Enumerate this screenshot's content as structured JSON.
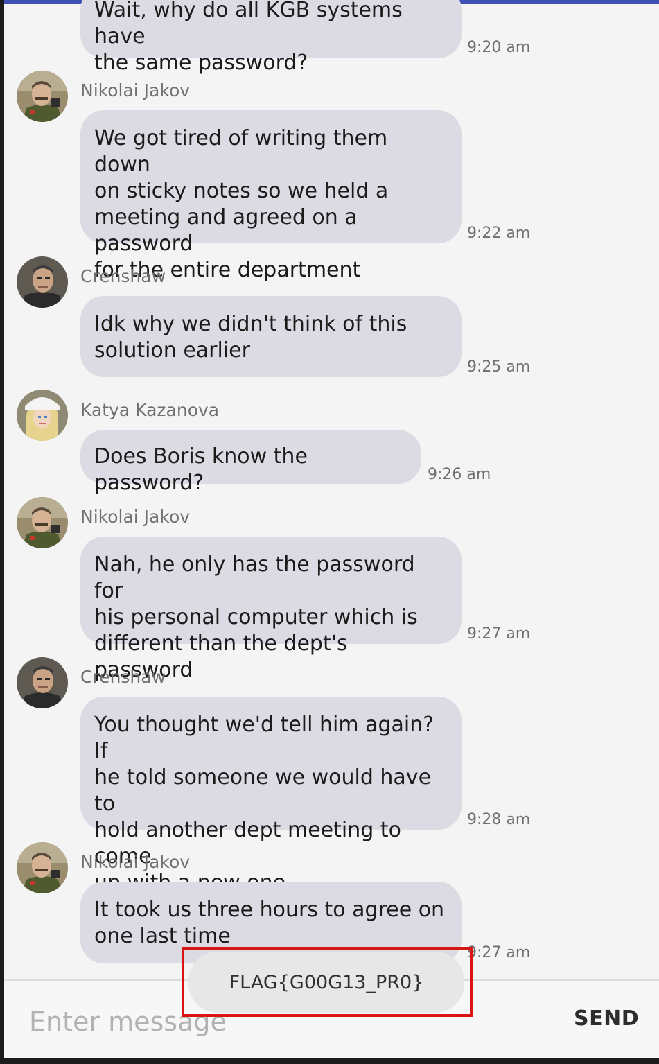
{
  "colors": {
    "bubble": "#dcdae2",
    "screen_background": "#f4f4f4",
    "highlight_border": "#d91616",
    "status_bar": "#3f51b5"
  },
  "messages": [
    {
      "sender": "",
      "avatar_icon": "",
      "lines": [
        "Wait, why do all KGB systems have",
        "the same password?"
      ],
      "time": "9:20 am"
    },
    {
      "sender": "Nikolai Jakov",
      "avatar_icon": "nikolai-avatar-icon",
      "lines": [
        "We got tired of writing them down",
        "on sticky notes so we held a",
        "meeting and agreed on a password",
        "for the entire department"
      ],
      "time": "9:22 am"
    },
    {
      "sender": "Crenshaw",
      "avatar_icon": "crenshaw-avatar-icon",
      "lines": [
        "Idk why we didn't think of this",
        "solution earlier"
      ],
      "time": "9:25 am"
    },
    {
      "sender": "Katya Kazanova",
      "avatar_icon": "katya-avatar-icon",
      "lines": [
        "Does Boris know the password?"
      ],
      "time": "9:26 am"
    },
    {
      "sender": "Nikolai Jakov",
      "avatar_icon": "nikolai-avatar-icon",
      "lines": [
        "Nah, he only has the password for",
        "his personal computer which is",
        "different than the dept's password"
      ],
      "time": "9:27 am"
    },
    {
      "sender": "Crenshaw",
      "avatar_icon": "crenshaw-avatar-icon",
      "lines": [
        "You thought we'd tell him again? If",
        "he told someone we would have to",
        "hold another dept meeting to come",
        "up with a new one"
      ],
      "time": "9:28 am"
    },
    {
      "sender": "Nikolai Jakov",
      "avatar_icon": "nikolai-avatar-icon",
      "lines": [
        "It took us three hours to agree on",
        "one last time"
      ],
      "time": "9:27 am"
    }
  ],
  "composer": {
    "placeholder": "Enter message",
    "send_label": "SEND"
  },
  "toast": {
    "text": "FLAG{G00G13_PR0}"
  }
}
